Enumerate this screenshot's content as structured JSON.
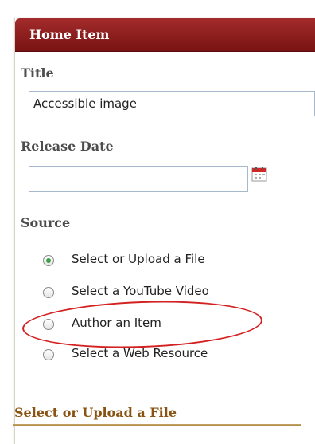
{
  "header": {
    "title": "Home Item"
  },
  "fields": {
    "title_label": "Title",
    "title_value": "Accessible image",
    "release_date_label": "Release Date",
    "release_date_value": "",
    "source_label": "Source"
  },
  "source_options": [
    {
      "label": "Select or Upload a File",
      "checked": true
    },
    {
      "label": "Select a YouTube Video",
      "checked": false
    },
    {
      "label": "Author an Item",
      "checked": false,
      "highlighted": true
    },
    {
      "label": "Select a Web Resource",
      "checked": false
    }
  ],
  "section": {
    "title": "Select or Upload a File"
  },
  "colors": {
    "header_bg": "#8b1a1a",
    "radio_checked": "#3aa043",
    "highlight": "#d42020",
    "section_title": "#8a5312"
  },
  "icons": {
    "date_picker": "calendar-icon"
  }
}
